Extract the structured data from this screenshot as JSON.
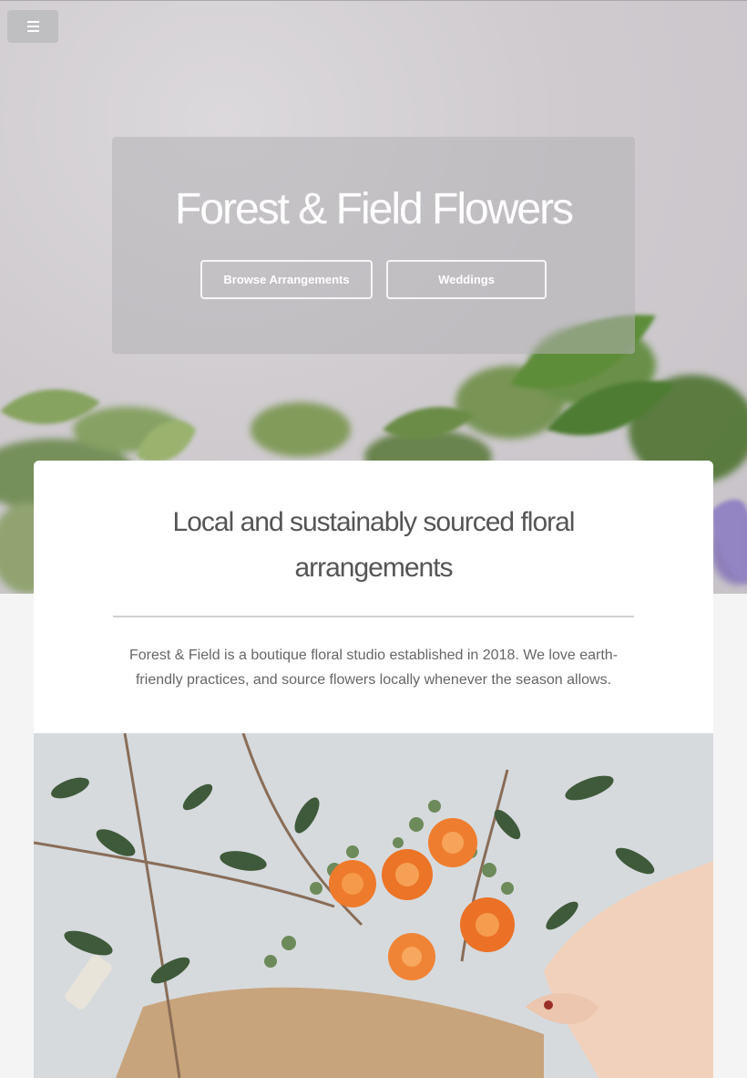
{
  "nav": {
    "menu_icon": "hamburger-menu-icon"
  },
  "hero": {
    "title": "Forest & Field Flowers",
    "buttons": [
      {
        "label": "Browse Arrangements"
      },
      {
        "label": "Weddings"
      }
    ]
  },
  "intro": {
    "heading": "Local and sustainably sourced floral arrangements",
    "body": "Forest & Field is a boutique floral studio established in 2018. We love earth-friendly practices, and source flowers locally whenever the season allows."
  },
  "colors": {
    "page_background": "#f4f4f4",
    "card_background": "#ffffff",
    "heading_text": "#555555",
    "body_text": "#666666",
    "flower_orange": "#ee7a2c"
  }
}
